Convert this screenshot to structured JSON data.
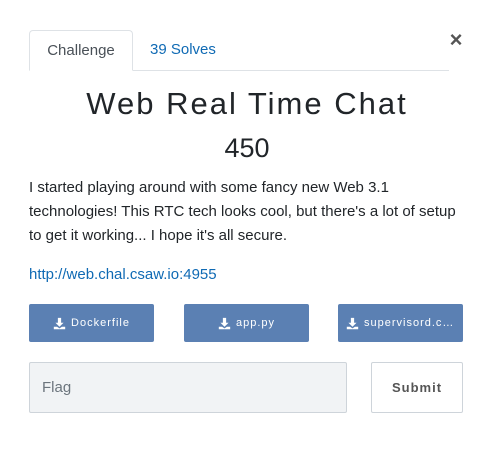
{
  "tabs": [
    {
      "label": "Challenge",
      "active": true
    },
    {
      "label": "39 Solves",
      "active": false
    }
  ],
  "close_symbol": "×",
  "challenge": {
    "name": "Web Real Time Chat",
    "points": "450",
    "description": "I started playing around with some fancy new Web 3.1 technologies! This RTC tech looks cool, but there's a lot of setup to get it working... I hope it's all secure.",
    "link": "http://web.chal.csaw.io:4955"
  },
  "files": [
    {
      "label": "Dockerfile",
      "icon": "download-icon"
    },
    {
      "label": "app.py",
      "icon": "download-icon"
    },
    {
      "label": "supervisord.conf",
      "icon": "download-icon"
    }
  ],
  "flag_input": {
    "placeholder": "Flag",
    "value": ""
  },
  "submit_label": "Submit",
  "colors": {
    "file_button_bg": "#5b80b3",
    "link": "#0f6ab4",
    "input_bg": "#f1f3f5"
  }
}
